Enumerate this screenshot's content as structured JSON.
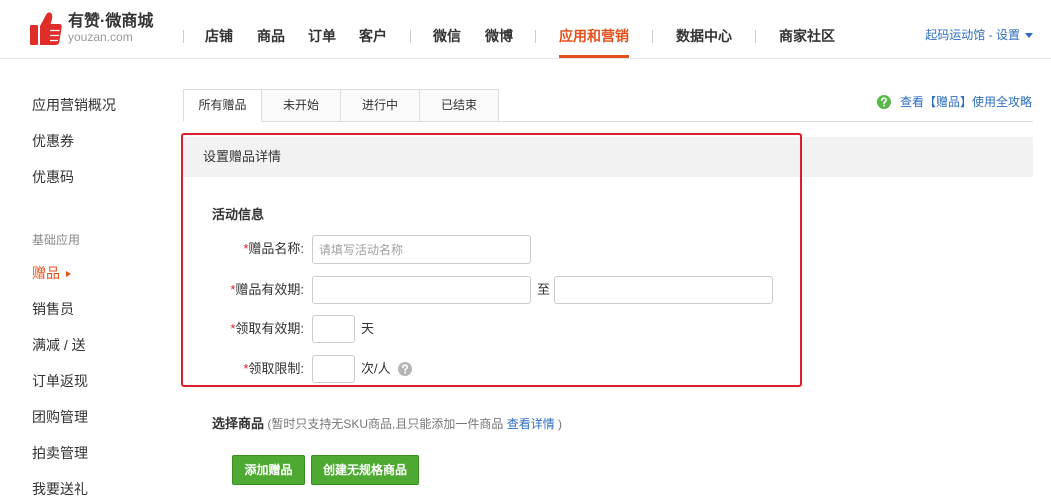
{
  "colors": {
    "accent": "#e5511d",
    "link": "#2e6dc2",
    "highlight": "#d8202b",
    "button": "#4da931",
    "button_border": "#3b8c22",
    "help": "#58b94a",
    "logo": "#e02d2a"
  },
  "header": {
    "logo_icon": "thumbs-up-icon",
    "brand": "有赞·微商城",
    "domain": "youzan.com",
    "nav": [
      {
        "label": "店铺"
      },
      {
        "label": "商品"
      },
      {
        "label": "订单"
      },
      {
        "label": "客户"
      },
      {
        "label": "微信"
      },
      {
        "label": "微博"
      },
      {
        "label": "应用和营销",
        "active": true
      },
      {
        "label": "数据中心"
      },
      {
        "label": "商家社区"
      }
    ],
    "account": {
      "store": "起码运动馆",
      "separator": "-",
      "settings": "设置",
      "icon": "caret-down-icon"
    }
  },
  "sidebar": {
    "items": [
      {
        "label": "应用营销概况"
      },
      {
        "label": "优惠券"
      },
      {
        "label": "优惠码"
      }
    ],
    "section_label": "基础应用",
    "section_items": [
      {
        "label": "赠品",
        "active": true,
        "icon": "caret-right-icon"
      },
      {
        "label": "销售员"
      },
      {
        "label": "满减 / 送"
      },
      {
        "label": "订单返现"
      },
      {
        "label": "团购管理"
      },
      {
        "label": "拍卖管理"
      },
      {
        "label": "我要送礼"
      }
    ]
  },
  "tabs": [
    {
      "label": "所有赠品",
      "active": true
    },
    {
      "label": "未开始"
    },
    {
      "label": "进行中"
    },
    {
      "label": "已结束"
    }
  ],
  "help_link": {
    "icon": "help-circle-icon",
    "text": "查看【赠品】使用全攻略"
  },
  "panel": {
    "title": "设置赠品详情"
  },
  "form": {
    "section_title": "活动信息",
    "fields": [
      {
        "required": "*",
        "label": "赠品名称:",
        "placeholder": "请填写活动名称"
      },
      {
        "required": "*",
        "label": "赠品有效期:",
        "separator": "至"
      },
      {
        "required": "*",
        "label": "领取有效期:",
        "unit": "天"
      },
      {
        "required": "*",
        "label": "领取限制:",
        "unit": "次/人",
        "help_icon": "question-circle-icon"
      }
    ]
  },
  "select_goods": {
    "title": "选择商品",
    "note_open": " (暂时只支持无SKU商品,且只能添加一件商品 ",
    "link": "查看详情",
    "note_close": " )"
  },
  "actions": {
    "add_gift": "添加赠品",
    "create_product": "创建无规格商品"
  }
}
